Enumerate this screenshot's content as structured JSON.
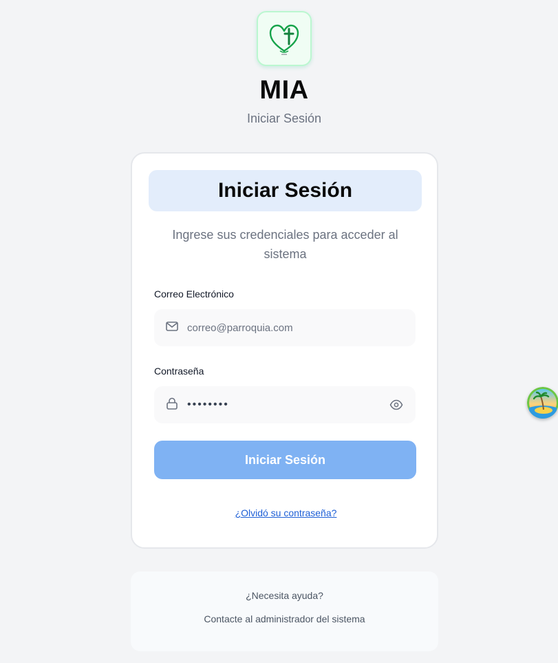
{
  "app": {
    "title": "MIA",
    "subtitle": "Iniciar Sesión"
  },
  "card": {
    "heading": "Iniciar Sesión",
    "description": "Ingrese sus credenciales para acceder al sistema"
  },
  "form": {
    "email_label": "Correo Electrónico",
    "email_placeholder": "correo@parroquia.com",
    "password_label": "Contraseña",
    "password_value": "••••••••",
    "submit_label": "Iniciar Sesión",
    "forgot_link": "¿Olvidó su contraseña?"
  },
  "help": {
    "title": "¿Necesita ayuda?",
    "text": "Contacte al administrador del sistema"
  },
  "icons": {
    "logo": "heart-cross-icon",
    "email": "mail-icon",
    "password": "lock-icon",
    "toggle_visibility": "eye-icon",
    "floating": "tropical-island-icon"
  },
  "colors": {
    "brand_green": "#16a34a",
    "primary_button": "#7fb2f3",
    "header_bg": "#e3edfb",
    "link": "#1d5fd6",
    "page_bg": "#f3f4f6"
  }
}
